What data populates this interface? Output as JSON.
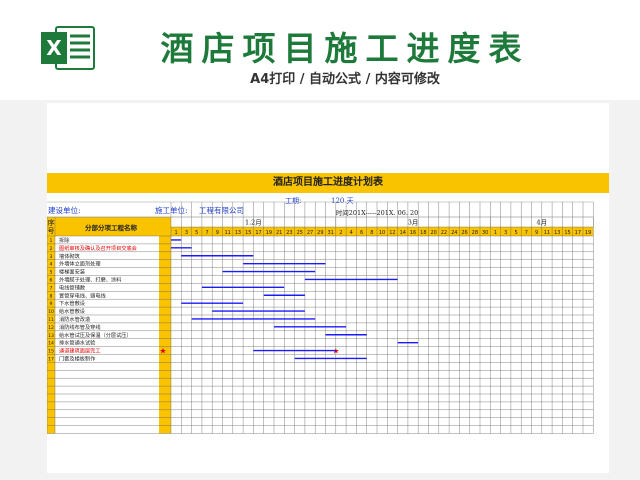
{
  "app": {
    "logo_letter": "X",
    "title": "酒店项目施工进度表",
    "subtitle": "A4打印 / 自动公式 / 内容可修改"
  },
  "sheet": {
    "title": "酒店项目施工进度计划表",
    "period_label": "工期:",
    "period_value": "120 天",
    "build_unit_label": "建设单位:",
    "construction_unit_label": "施工单位:",
    "construction_unit_value": "工程有限公司",
    "time_range": "时间201X-----201X. 06. 20",
    "header_seq": "序号",
    "header_name": "分部分项工程名称",
    "months": [
      "1.2月",
      "3月",
      "4月"
    ],
    "day_numbers": [
      "1",
      "3",
      "5",
      "7",
      "9",
      "11",
      "13",
      "15",
      "17",
      "19",
      "21",
      "23",
      "25",
      "27",
      "29",
      "31",
      "2",
      "4",
      "6",
      "8",
      "10",
      "12",
      "14",
      "16",
      "18",
      "20",
      "22",
      "24",
      "26",
      "28",
      "30",
      "1",
      "3",
      "5",
      "7",
      "9",
      "11",
      "13",
      "15",
      "17",
      "19"
    ],
    "milestone_symbol": "★",
    "tasks": [
      {
        "no": "1",
        "name": "拆除",
        "highlight": false,
        "start": 0,
        "end": 1
      },
      {
        "no": "2",
        "name": "图纸审核及确认及召开项目交底会",
        "highlight": true,
        "start": 0,
        "end": 2
      },
      {
        "no": "3",
        "name": "墙体砌筑",
        "highlight": false,
        "start": 1,
        "end": 8
      },
      {
        "no": "4",
        "name": "外墙体立面剂处理",
        "highlight": false,
        "start": 7,
        "end": 15
      },
      {
        "no": "5",
        "name": "楼梯面安装",
        "highlight": false,
        "start": 5,
        "end": 14
      },
      {
        "no": "6",
        "name": "外墙腻子处理、打磨、涂料",
        "highlight": false,
        "start": 13,
        "end": 22
      },
      {
        "no": "7",
        "name": "电线管铺敷",
        "highlight": false,
        "start": 3,
        "end": 11
      },
      {
        "no": "8",
        "name": "置管穿电线、弱电线",
        "highlight": false,
        "start": 9,
        "end": 13
      },
      {
        "no": "9",
        "name": "下水管敷设",
        "highlight": false,
        "start": 1,
        "end": 7
      },
      {
        "no": "10",
        "name": "给水管敷设",
        "highlight": false,
        "start": 4,
        "end": 13
      },
      {
        "no": "11",
        "name": "消防水管改造",
        "highlight": false,
        "start": 2,
        "end": 14
      },
      {
        "no": "12",
        "name": "消防线布管及穿线",
        "highlight": false,
        "start": 10,
        "end": 17
      },
      {
        "no": "13",
        "name": "给水管试压及保温（分层试压）",
        "highlight": false,
        "start": 15,
        "end": 19
      },
      {
        "no": "14",
        "name": "排水管通水试验",
        "highlight": false,
        "start": 22,
        "end": 24
      },
      {
        "no": "15",
        "name": "通道建筑面层完工",
        "highlight": true,
        "star": true,
        "start": 8,
        "end": 16
      },
      {
        "no": "17",
        "name": "门套及楼板制作",
        "highlight": false,
        "start": 12,
        "end": 19
      }
    ]
  },
  "colors": {
    "excel_green": "#1e7a3a",
    "header_yellow": "#f9c300",
    "bar_blue": "#1a1aff",
    "red_text": "#e00000"
  }
}
